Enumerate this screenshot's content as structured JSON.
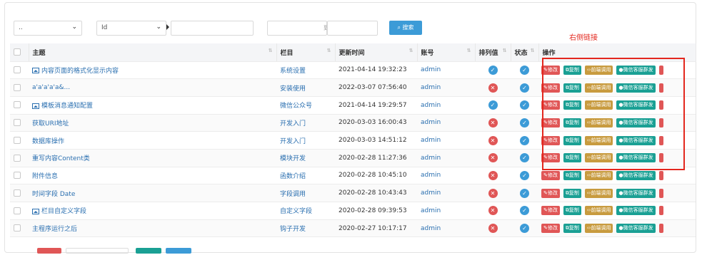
{
  "filters": {
    "select1": "..",
    "select2": "Id",
    "range_sep": "到",
    "search_label": "搜索"
  },
  "annotation": "右侧链接",
  "table": {
    "headers": [
      "主题",
      "栏目",
      "更新时间",
      "账号",
      "排列值",
      "状态",
      "操作"
    ],
    "rows": [
      {
        "title": "内容页面的格式化显示内容",
        "has_img": true,
        "category": "系统设置",
        "time": "2021-04-14 19:32:23",
        "user": "admin",
        "sort_ok": true
      },
      {
        "title": "a'a'a'a'a&...",
        "has_img": false,
        "category": "安装使用",
        "time": "2022-03-07 07:56:40",
        "user": "admin",
        "sort_ok": false
      },
      {
        "title": "模板消息通知配置",
        "has_img": true,
        "category": "微信公众号",
        "time": "2021-04-14 19:29:57",
        "user": "admin",
        "sort_ok": true
      },
      {
        "title": "获取URI地址",
        "has_img": false,
        "category": "开发入门",
        "time": "2020-03-03 16:00:43",
        "user": "admin",
        "sort_ok": false
      },
      {
        "title": "数据库操作",
        "has_img": false,
        "category": "开发入门",
        "time": "2020-03-03 14:51:12",
        "user": "admin",
        "sort_ok": false
      },
      {
        "title": "重写内容Content类",
        "has_img": false,
        "category": "模块开发",
        "time": "2020-02-28 11:27:36",
        "user": "admin",
        "sort_ok": false
      },
      {
        "title": "附件信息",
        "has_img": false,
        "category": "函数介绍",
        "time": "2020-02-28 10:45:10",
        "user": "admin",
        "sort_ok": false
      },
      {
        "title": "时间字段 Date",
        "has_img": false,
        "category": "字段调用",
        "time": "2020-02-28 10:43:43",
        "user": "admin",
        "sort_ok": false
      },
      {
        "title": "栏目自定义字段",
        "has_img": true,
        "category": "自定义字段",
        "time": "2020-02-28 09:39:53",
        "user": "admin",
        "sort_ok": false
      },
      {
        "title": "主程序运行之后",
        "has_img": false,
        "category": "钩子开发",
        "time": "2020-02-27 10:17:17",
        "user": "admin",
        "sort_ok": false
      }
    ],
    "actions": {
      "edit": "修改",
      "copy": "复制",
      "call": "前端调用",
      "wechat": "微信客服群发"
    }
  },
  "icons": {
    "edit": "edit-icon",
    "copy": "copy-icon",
    "call": "code-icon",
    "wechat": "wechat-icon",
    "check": "check-icon",
    "cross": "cross-icon"
  },
  "colors": {
    "primary": "#3c9bd7",
    "danger": "#e05656",
    "teal": "#1aa094",
    "gold": "#c89b3f",
    "link": "#2a6fb0",
    "annotation": "#e3271e"
  }
}
